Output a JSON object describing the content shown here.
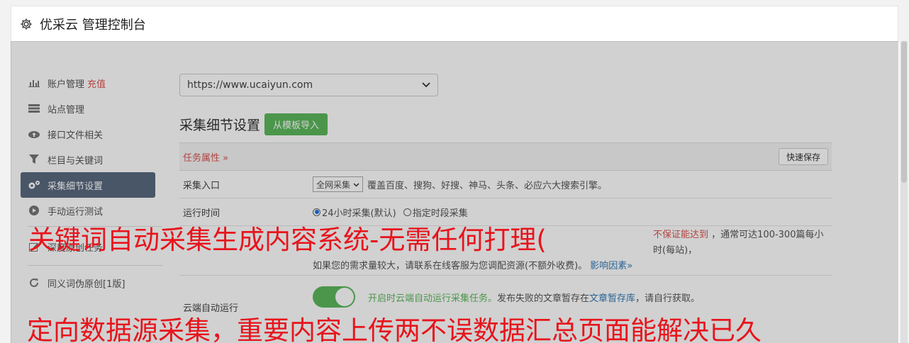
{
  "header": {
    "title": "优采云 管理控制台"
  },
  "sidebar": {
    "items": [
      {
        "label": "账户管理",
        "extra": "充值",
        "icon": "bar-chart-icon"
      },
      {
        "label": "站点管理",
        "icon": "server-icon"
      },
      {
        "label": "接口文件相关",
        "icon": "cloud-upload-icon"
      },
      {
        "label": "栏目与关键词",
        "icon": "filter-icon"
      },
      {
        "label": "采集细节设置",
        "icon": "gears-icon",
        "active": true
      },
      {
        "label": "手动运行测试",
        "icon": "play-circle-icon"
      },
      {
        "label": "深度原创任务",
        "icon": "edit-icon"
      },
      {
        "label": "同义词伪原创[1版]",
        "icon": "refresh-icon"
      }
    ]
  },
  "main": {
    "site_select": "https://www.ucaiyun.com",
    "section_title": "采集细节设置",
    "import_button": "从模板导入",
    "task_props": "任务属性 »",
    "quick_save": "快速保存",
    "rows": {
      "entry_label": "采集入口",
      "entry_select": "全网采集",
      "entry_desc": "覆盖百度、搜狗、好搜、神马、头条、必应六大搜索引擎。",
      "time_label": "运行时间",
      "time_opt1": "24小时采集(默认)",
      "time_opt2": "指定时段采集",
      "speed_text1": "，通常可达100-300篇每小时(每站)，",
      "speed_red": "不保证能达到",
      "speed_text2": "如果您的需求量较大，请联系在线客服为您调配资源(不额外收费)。",
      "speed_link": "影响因素»",
      "cloud_label": "云端自动运行",
      "cloud_green": "开启时云端自动运行采集任务。",
      "cloud_text": "发布失败的文章暂存在",
      "cloud_link": "文章暂存库",
      "cloud_text2": "，请自行获取。"
    }
  },
  "overlay_text": {
    "top": "关键词自动采集生成内容系统-无需任何打理(",
    "bottom": "定向数据源采集，重要内容上传两不误数据汇总页面能解决已久"
  },
  "colors": {
    "accent_red": "#e8141c",
    "green": "#5cb85c",
    "active_bg": "#5a6a7f"
  }
}
